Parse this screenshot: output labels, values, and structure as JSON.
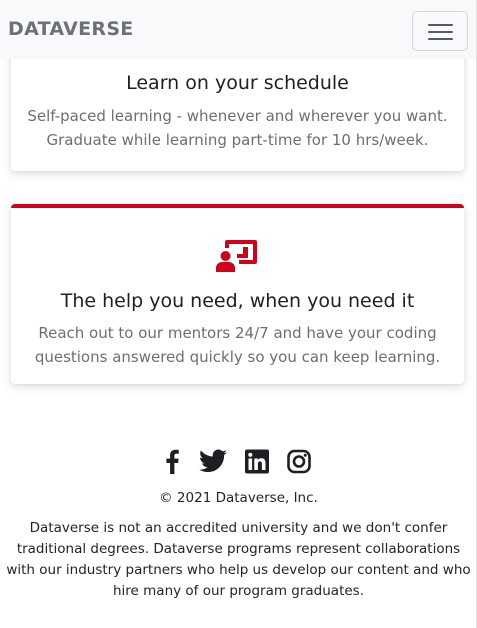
{
  "navbar": {
    "brand": "DATAVERSE",
    "toggler_icon": "hamburger-menu-icon"
  },
  "cards": [
    {
      "title": "Learn on your schedule",
      "text": "Self-paced learning - whenever and wherever you want. Graduate while learning part-time for 10 hrs/week."
    },
    {
      "icon": "teacher-chalkboard-icon",
      "title": "The help you need, when you need it",
      "text": "Reach out to our mentors 24/7 and have your coding questions answered quickly so you can keep learning."
    }
  ],
  "footer": {
    "social": [
      "facebook-icon",
      "twitter-icon",
      "linkedin-icon",
      "instagram-icon"
    ],
    "copyright": "© 2021 Dataverse, Inc.",
    "disclaimer": "Dataverse is not an accredited university and we don't confer traditional degrees. Dataverse programs represent collaborations with our industry partners who help us develop our content and who hire many of our program graduates."
  },
  "colors": {
    "accent": "#d0021b",
    "navbar_bg": "#f8f9fa",
    "brand": "#6c7178",
    "muted_text": "#6a6f75"
  }
}
